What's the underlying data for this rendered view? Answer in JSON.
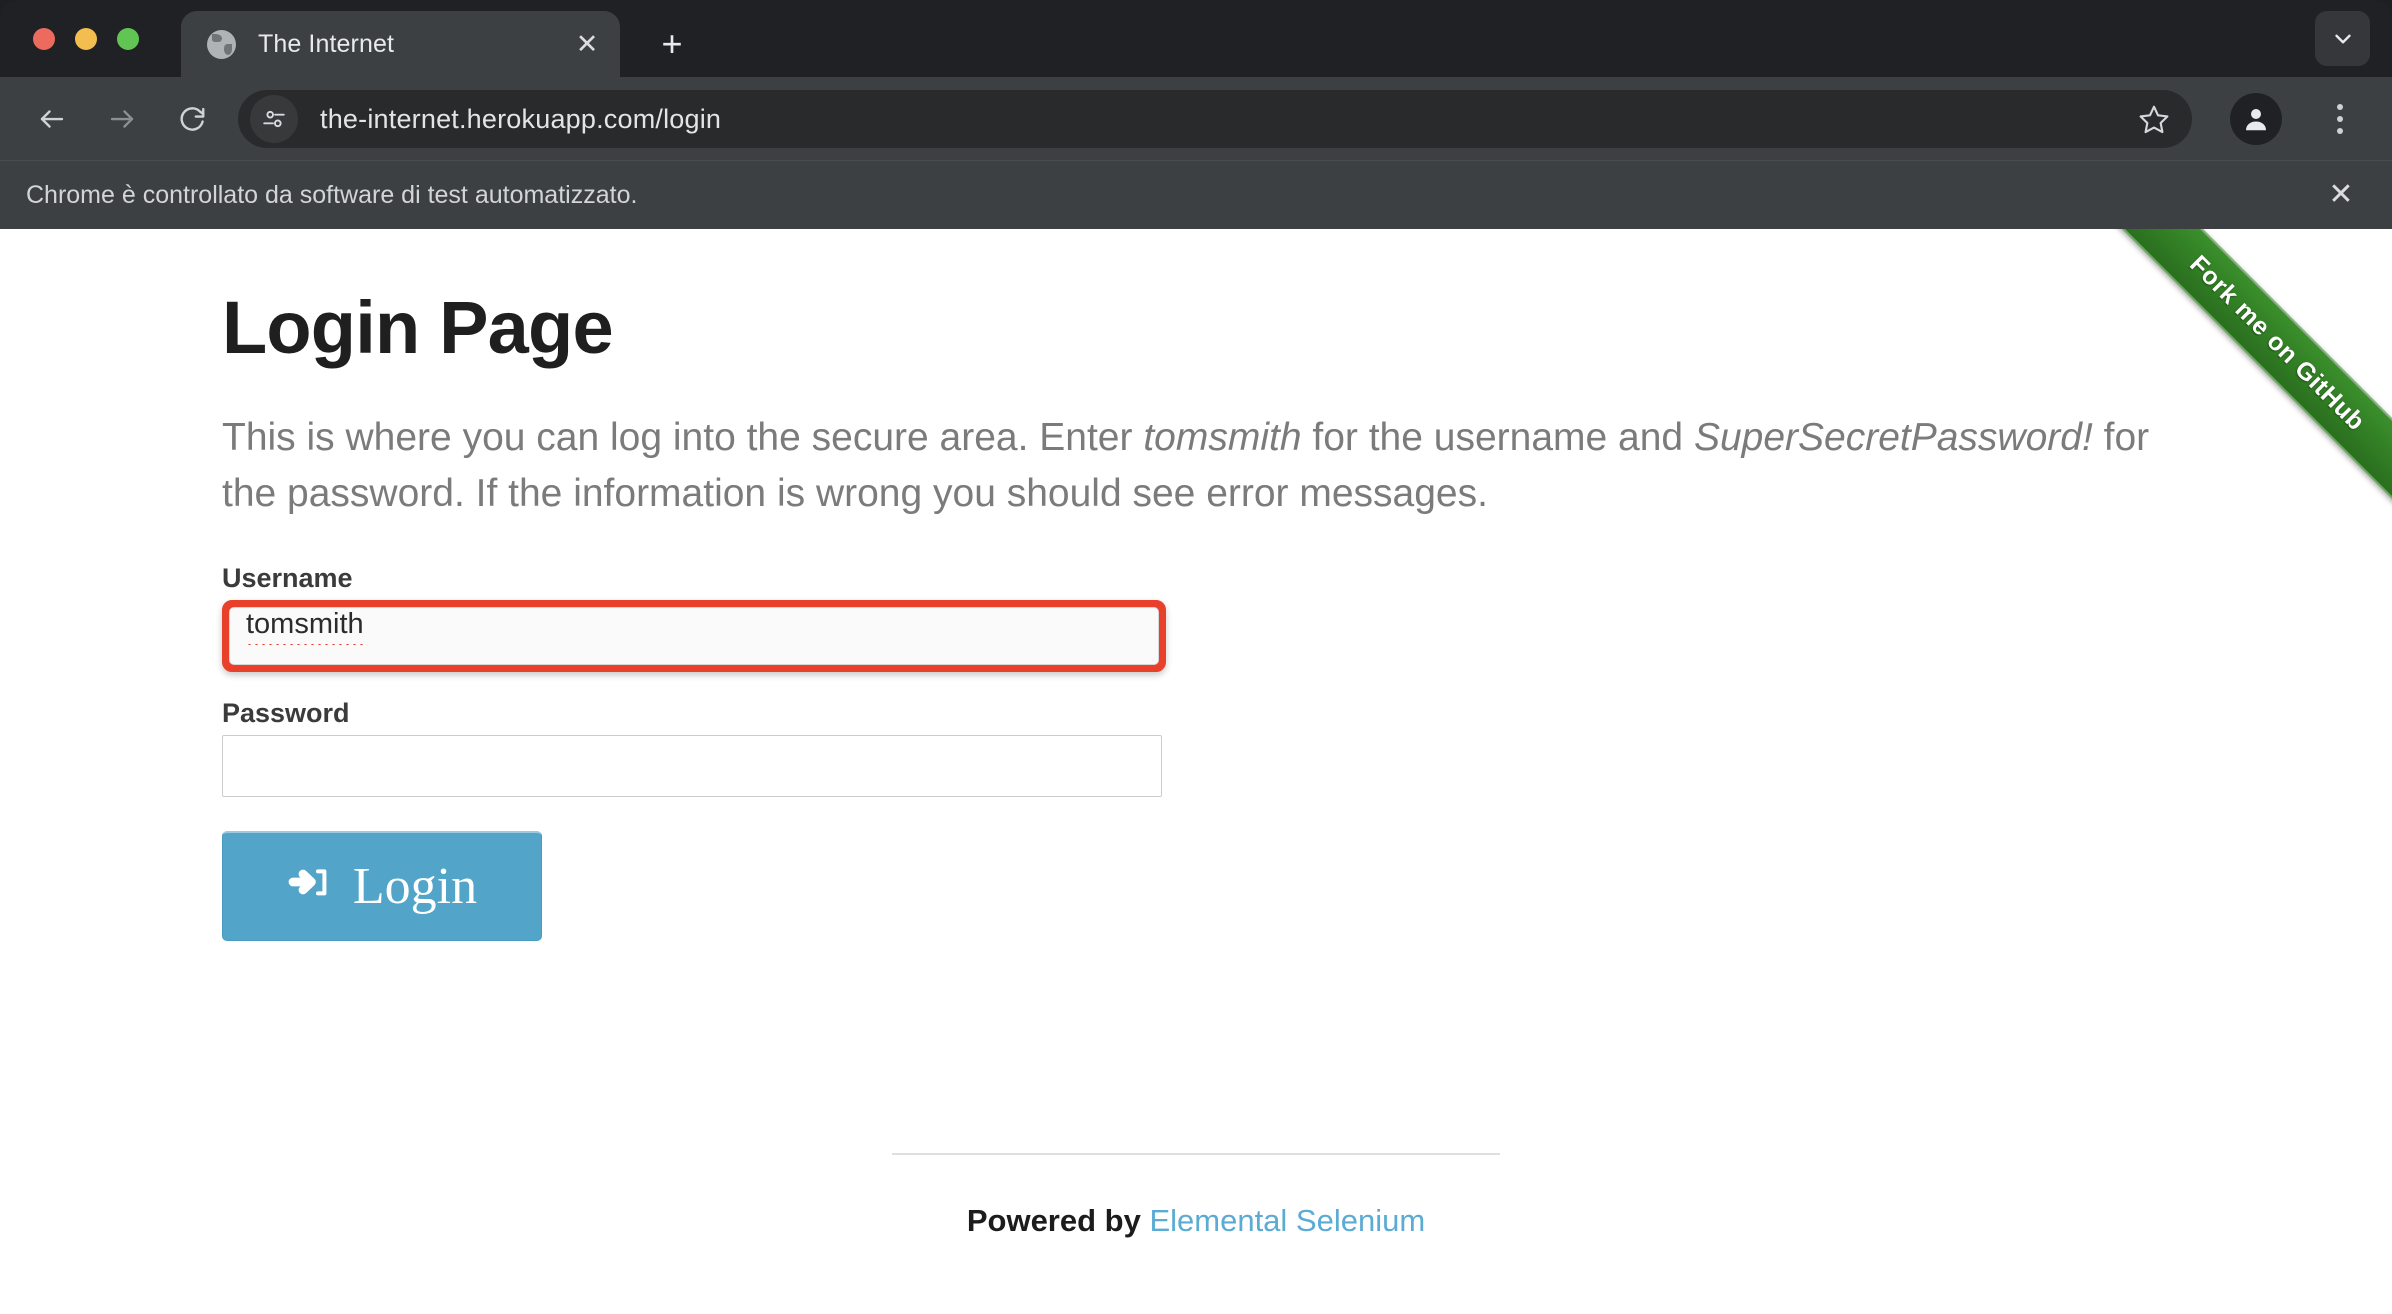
{
  "browser": {
    "window_controls": [
      "close",
      "minimize",
      "maximize"
    ],
    "tab": {
      "title": "The Internet",
      "favicon": "globe-icon",
      "close_label": "✕"
    },
    "new_tab_label": "+",
    "expand_label": "⌄",
    "toolbar": {
      "back_label": "back-arrow-icon",
      "forward_label": "forward-arrow-icon",
      "reload_label": "reload-icon",
      "site_info_icon": "tune-icon",
      "url": "the-internet.herokuapp.com/login",
      "url_placeholder": "Search Google or type a URL",
      "bookmark_icon": "star-icon",
      "profile_icon": "person-icon",
      "menu_icon": "three-dots-icon"
    },
    "infobar": {
      "message": "Chrome è controllato da software di test automatizzato.",
      "close_label": "✕"
    }
  },
  "page": {
    "ribbon": "Fork me on GitHub",
    "title": "Login Page",
    "description": {
      "part1": "This is where you can log into the secure area. Enter ",
      "em1": "tomsmith",
      "part2": " for the username and ",
      "em2": "SuperSecretPassword!",
      "part3": " for the password. If the information is wrong you should see error messages."
    },
    "form": {
      "username_label": "Username",
      "username_value": "tomsmith",
      "username_placeholder": "",
      "password_label": "Password",
      "password_value": "",
      "password_placeholder": "",
      "submit_label": "Login",
      "submit_icon": "sign-in-icon"
    },
    "footer": {
      "powered_by": "Powered by ",
      "link_text": "Elemental Selenium"
    }
  },
  "colors": {
    "accent_button": "#52a4c9",
    "highlight_border": "#e8402a",
    "ribbon_green": "#2c7a20",
    "link_blue": "#5babd4",
    "chrome_tabstrip": "#202124",
    "chrome_toolbar": "#3c4043"
  }
}
